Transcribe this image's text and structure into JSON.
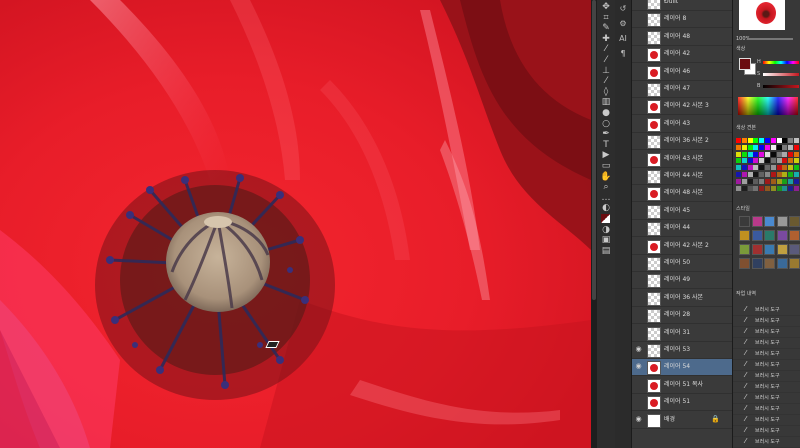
{
  "canvas": {
    "accent": "#e8202c"
  },
  "toolbar": {
    "tools": [
      "move-icon",
      "crop-icon",
      "eyedropper-icon",
      "healing-icon",
      "brush-icon",
      "mixer-brush-icon",
      "clone-stamp-icon",
      "history-brush-icon",
      "eraser-icon",
      "gradient-icon",
      "blur-icon",
      "dodge-icon",
      "pen-icon",
      "type-icon",
      "path-select-icon",
      "rectangle-icon",
      "hand-icon",
      "zoom-icon",
      "more-icon",
      "quickmask-icon",
      "color-swatch-icon",
      "mode-icon",
      "screen-mode-icon",
      "frame-icon"
    ]
  },
  "minibar": {
    "items": [
      "history-icon",
      "properties-icon",
      "ai-icon",
      "paragraph-icon"
    ],
    "labels": [
      "",
      "",
      "AI",
      "¶"
    ]
  },
  "layers": {
    "items": [
      {
        "name": "Ðuiit",
        "thumb": "checker",
        "visible": false,
        "selected": false
      },
      {
        "name": "레이어 8",
        "thumb": "checker",
        "visible": false,
        "selected": false
      },
      {
        "name": "레이어 48",
        "thumb": "checker",
        "visible": false,
        "selected": false
      },
      {
        "name": "레이어 42",
        "thumb": "red",
        "visible": false,
        "selected": false
      },
      {
        "name": "레이어 46",
        "thumb": "red",
        "visible": false,
        "selected": false
      },
      {
        "name": "레이어 47",
        "thumb": "checker",
        "visible": false,
        "selected": false
      },
      {
        "name": "레이어 42 사본 3",
        "thumb": "red",
        "visible": false,
        "selected": false
      },
      {
        "name": "레이어 43",
        "thumb": "red",
        "visible": false,
        "selected": false
      },
      {
        "name": "레이어 36 사본 2",
        "thumb": "checker",
        "visible": false,
        "selected": false
      },
      {
        "name": "레이어 43 사본",
        "thumb": "red",
        "visible": false,
        "selected": false
      },
      {
        "name": "레이어 44 사본",
        "thumb": "checker",
        "visible": false,
        "selected": false
      },
      {
        "name": "레이어 48 사본",
        "thumb": "red",
        "visible": false,
        "selected": false
      },
      {
        "name": "레이어 45",
        "thumb": "checker",
        "visible": false,
        "selected": false
      },
      {
        "name": "레이어 44",
        "thumb": "checker",
        "visible": false,
        "selected": false
      },
      {
        "name": "레이어 42 사본 2",
        "thumb": "red",
        "visible": false,
        "selected": false
      },
      {
        "name": "레이어 50",
        "thumb": "checker",
        "visible": false,
        "selected": false
      },
      {
        "name": "레이어 49",
        "thumb": "checker",
        "visible": false,
        "selected": false
      },
      {
        "name": "레이어 36 사본",
        "thumb": "checker",
        "visible": false,
        "selected": false
      },
      {
        "name": "레이어 28",
        "thumb": "checker",
        "visible": false,
        "selected": false
      },
      {
        "name": "레이어 31",
        "thumb": "checker",
        "visible": false,
        "selected": false
      },
      {
        "name": "레이어 53",
        "thumb": "checker",
        "visible": true,
        "selected": false
      },
      {
        "name": "레이어 54",
        "thumb": "red",
        "visible": true,
        "selected": true
      },
      {
        "name": "레이어 51 복사",
        "thumb": "red",
        "visible": false,
        "selected": false
      },
      {
        "name": "레이어 51",
        "thumb": "red",
        "visible": false,
        "selected": false
      },
      {
        "name": "배경",
        "thumb": "white",
        "visible": true,
        "selected": false,
        "locked": true
      }
    ]
  },
  "right": {
    "zoom": "100%",
    "color_title": "색상",
    "color_labels": [
      "H",
      "S",
      "B"
    ],
    "fg_color": "#6b0c10",
    "bg_color": "#ffffff",
    "swatches_title": "색상 견본",
    "styles_title": "스타일",
    "history_title": "작업 내역",
    "history_items": [
      "브러시 도구",
      "브러시 도구",
      "브러시 도구",
      "브러시 도구",
      "브러시 도구",
      "브러시 도구",
      "브러시 도구",
      "브러시 도구",
      "브러시 도구",
      "브러시 도구",
      "브러시 도구",
      "브러시 도구",
      "브러시 도구"
    ]
  }
}
